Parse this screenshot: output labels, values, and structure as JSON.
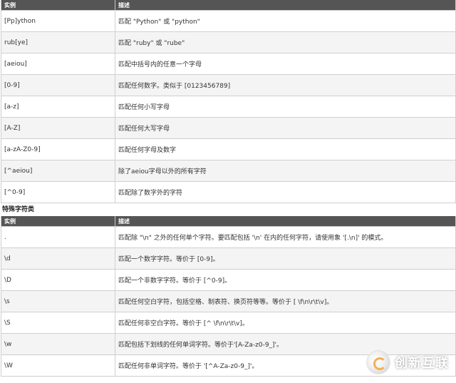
{
  "table1": {
    "headers": [
      "实例",
      "描述"
    ],
    "rows": [
      [
        "[Pp]ython",
        "匹配 \"Python\" 或 \"python\""
      ],
      [
        "rub[ye]",
        "匹配 \"ruby\" 或 \"rube\""
      ],
      [
        "[aeiou]",
        "匹配中括号内的任意一个字母"
      ],
      [
        "[0-9]",
        "匹配任何数字。类似于 [0123456789]"
      ],
      [
        "[a-z]",
        "匹配任何小写字母"
      ],
      [
        "[A-Z]",
        "匹配任何大写字母"
      ],
      [
        "[a-zA-Z0-9]",
        "匹配任何字母及数字"
      ],
      [
        "[^aeiou]",
        "除了aeiou字母以外的所有字符"
      ],
      [
        "[^0-9]",
        "匹配除了数字外的字符"
      ]
    ]
  },
  "section_title": "特殊字符类",
  "table2": {
    "headers": [
      "实例",
      "描述"
    ],
    "rows": [
      [
        ".",
        "匹配除 \"\\n\" 之外的任何单个字符。要匹配包括 '\\n' 在内的任何字符，请使用象 '[.\\n]' 的模式。"
      ],
      [
        "\\d",
        "匹配一个数字字符。等价于 [0-9]。"
      ],
      [
        "\\D",
        "匹配一个非数字字符。等价于 [^0-9]。"
      ],
      [
        "\\s",
        "匹配任何空白字符，包括空格、制表符、换页符等等。等价于 [ \\f\\n\\r\\t\\v]。"
      ],
      [
        "\\S",
        "匹配任何非空白字符。等价于 [^ \\f\\n\\r\\t\\v]。"
      ],
      [
        "\\w",
        "匹配包括下划线的任何单词字符。等价于'[A-Za-z0-9_]'。"
      ],
      [
        "\\W",
        "匹配任何非单词字符。等价于 '[^A-Za-z0-9_]'。"
      ]
    ]
  },
  "watermark": {
    "text": "创新互联",
    "icon": "brand-logo-icon"
  }
}
